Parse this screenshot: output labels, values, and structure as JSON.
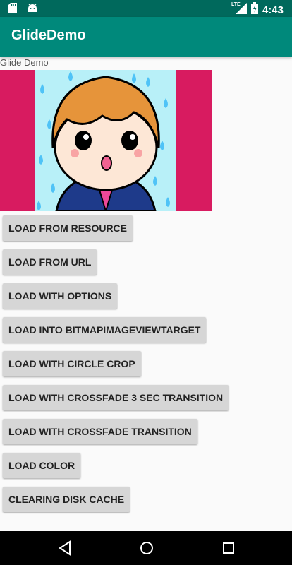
{
  "status_bar": {
    "network": "LTE",
    "time": "4:43",
    "icons": [
      "sd-card-icon",
      "android-icon",
      "signal-icon",
      "battery-icon"
    ]
  },
  "app_bar": {
    "title": "GlideDemo"
  },
  "caption": "Glide Demo",
  "image": {
    "description_icon": "cartoon-boy-image",
    "background_color": "#d81b60",
    "accent_color": "#00897b"
  },
  "buttons": [
    "LOAD FROM RESOURCE",
    "LOAD FROM URL",
    "LOAD WITH OPTIONS",
    "LOAD INTO BITMAPIMAGEVIEWTARGET",
    "LOAD WITH CIRCLE CROP",
    "LOAD WITH CROSSFADE 3 SEC TRANSITION",
    "LOAD WITH CROSSFADE TRANSITION",
    "LOAD COLOR",
    "CLEARING DISK CACHE"
  ],
  "nav_bar": {
    "icons": [
      "back-icon",
      "home-icon",
      "recents-icon"
    ]
  }
}
